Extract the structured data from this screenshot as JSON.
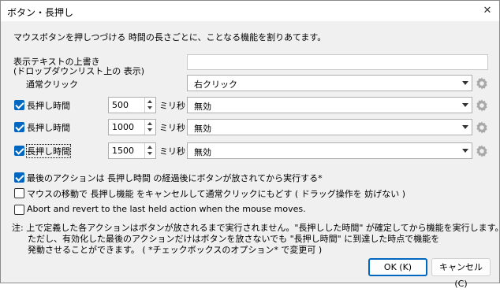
{
  "window": {
    "title": "ボタン・長押し",
    "close_glyph": "✕"
  },
  "description": "マウスボタンを押しつづける 時間の長さごとに、ことなる機能を割りあてます。",
  "override": {
    "label_line1": "表示テキストの上書き",
    "label_line2": "(ドロップダウンリスト上の 表示)",
    "value": ""
  },
  "normal_click": {
    "label": "通常クリック",
    "selected": "右クリック"
  },
  "long_press_rows": [
    {
      "label": "長押し時間",
      "checked": true,
      "value": "500",
      "unit": "ミリ秒",
      "selected": "無効"
    },
    {
      "label": "長押し時間",
      "checked": true,
      "value": "1000",
      "unit": "ミリ秒",
      "selected": "無効"
    },
    {
      "label": "長押し時間",
      "checked": true,
      "value": "1500",
      "unit": "ミリ秒",
      "selected": "無効"
    }
  ],
  "options": [
    {
      "label": "最後のアクションは 長押し時間 の経過後にボタンが放されてから実行する*",
      "checked": true
    },
    {
      "label": "マウスの移動で 長押し機能 をキャンセルして通常クリックにもどす ( ドラッグ操作を 妨げない )",
      "checked": false
    },
    {
      "label": "Abort and revert to the last held action when the mouse moves.",
      "checked": false
    }
  ],
  "note": {
    "line1": "注: 上で定義した各アクションはボタンが放されるまで実行されません。\"長押しした時間\" が確定してから機能を実行します。",
    "line2": "ただし、有効化した最後のアクションだけはボタンを放さないでも \"長押し時間\" に到達した時点で機能を",
    "line3": "発動させることができます。  ( *チェックボックスのオプション* で変更可 )"
  },
  "buttons": {
    "ok": "OK (K)",
    "cancel": "キャンセル (C)"
  },
  "colors": {
    "accent": "#0067c0",
    "window_bg": "#f0f0f0"
  }
}
